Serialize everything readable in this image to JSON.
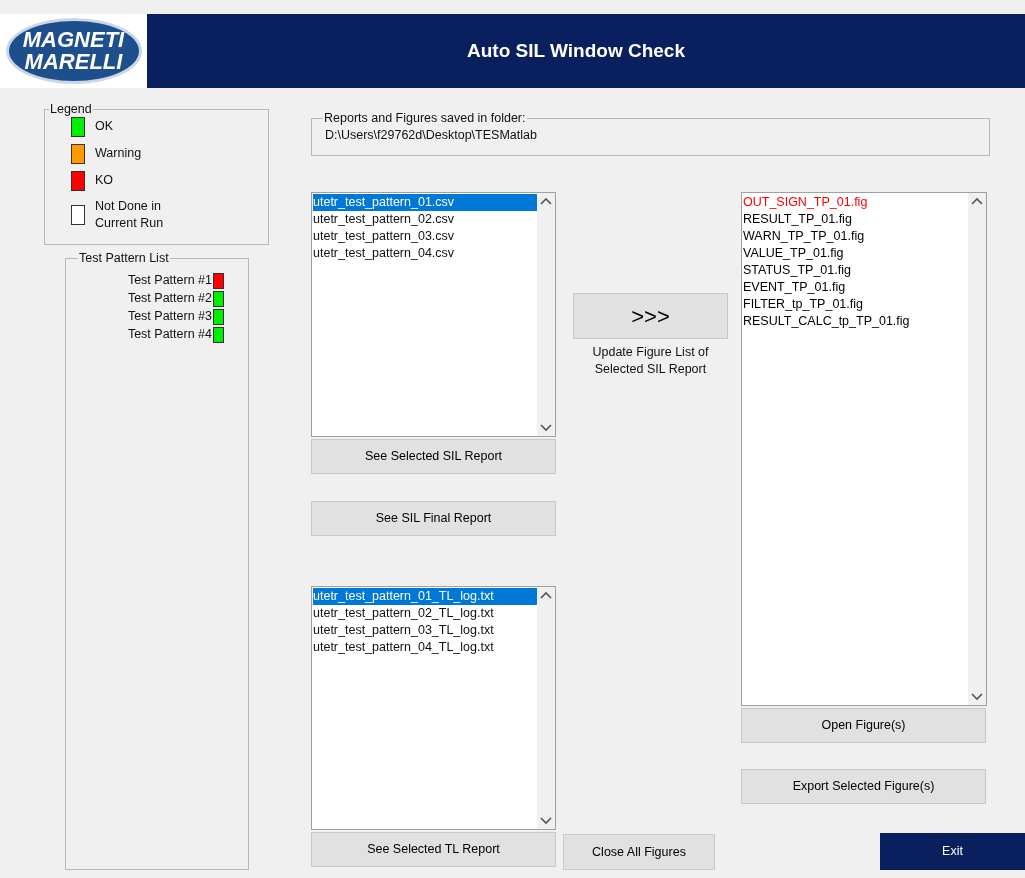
{
  "logo": {
    "lines": [
      "MAGNETI",
      "MARELLI"
    ]
  },
  "window": {
    "title": "Auto SIL Window Check"
  },
  "legend": {
    "title": "Legend",
    "items": [
      {
        "label": "OK",
        "color": "#00ee00"
      },
      {
        "label": "Warning",
        "color": "#ff9900"
      },
      {
        "label": "KO",
        "color": "#ff0000"
      },
      {
        "label": "Not Done in Current Run",
        "color": "#ffffff"
      }
    ]
  },
  "test_pattern_list": {
    "title": "Test Pattern List",
    "items": [
      {
        "label": "Test Pattern #1",
        "color": "#ff0000"
      },
      {
        "label": "Test Pattern #2",
        "color": "#00ee00"
      },
      {
        "label": "Test Pattern #3",
        "color": "#00ee00"
      },
      {
        "label": "Test Pattern #4",
        "color": "#00ee00"
      }
    ]
  },
  "folder": {
    "title": "Reports and Figures saved in folder:",
    "path": "D:\\Users\\f29762d\\Desktop\\TESMatlab"
  },
  "sil_reports": {
    "items": [
      {
        "label": "utetr_test_pattern_01.csv",
        "selected": true
      },
      {
        "label": "utetr_test_pattern_02.csv",
        "selected": false
      },
      {
        "label": "utetr_test_pattern_03.csv",
        "selected": false
      },
      {
        "label": "utetr_test_pattern_04.csv",
        "selected": false
      }
    ],
    "buttons": [
      "See Selected SIL Report",
      "See SIL Final Report"
    ]
  },
  "tl_reports": {
    "items": [
      {
        "label": "utetr_test_pattern_01_TL_log.txt",
        "selected": true
      },
      {
        "label": "utetr_test_pattern_02_TL_log.txt",
        "selected": false
      },
      {
        "label": "utetr_test_pattern_03_TL_log.txt",
        "selected": false
      },
      {
        "label": "utetr_test_pattern_04_TL_log.txt",
        "selected": false
      }
    ],
    "button": "See Selected TL Report"
  },
  "update": {
    "button": ">>>",
    "caption": "Update Figure List of Selected SIL Report"
  },
  "figures": {
    "items": [
      {
        "label": "OUT_SIGN_TP_01.fig",
        "color": "#ff0000"
      },
      {
        "label": "RESULT_TP_01.fig",
        "color": "#000000"
      },
      {
        "label": "WARN_TP_TP_01.fig",
        "color": "#000000"
      },
      {
        "label": "VALUE_TP_01.fig",
        "color": "#000000"
      },
      {
        "label": "STATUS_TP_01.fig",
        "color": "#000000"
      },
      {
        "label": "EVENT_TP_01.fig",
        "color": "#000000"
      },
      {
        "label": "FILTER_tp_TP_01.fig",
        "color": "#000000"
      },
      {
        "label": "RESULT_CALC_tp_TP_01.fig",
        "color": "#000000"
      }
    ],
    "buttons": [
      "Open Figure(s)",
      "Export Selected Figure(s)"
    ]
  },
  "close_button": "Close All Figures",
  "exit_button": "Exit"
}
